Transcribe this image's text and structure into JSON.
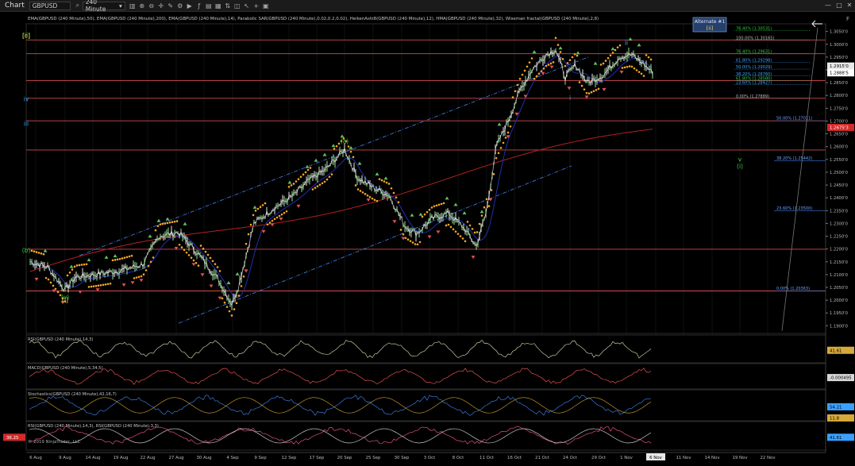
{
  "window": {
    "title": "Chart",
    "instrument": "GBPUSD",
    "timeframe": "240 Minute",
    "minimize": "—",
    "maximize": "□",
    "close": "✕"
  },
  "toolbar_icons": [
    "chart-type-icon",
    "zoom-in-icon",
    "zoom-out-icon",
    "crosshair-icon",
    "draw-tools-icon",
    "properties-icon",
    "strategy-icon",
    "indicators-icon",
    "templates-icon",
    "data-box-icon",
    "show-trades-icon",
    "snapshot-icon",
    "arrow-tools-icon",
    "plus-icon",
    "tile-icon"
  ],
  "main_panel": {
    "indicators_legend": "EMA(GBPUSD (240 Minute),50), EMA(GBPUSD (240 Minute),200), EMA(GBPUSD (240 Minute),14), Parabolic SAR(GBPUSD (240 Minute),0.02,0.2,0.02), HeikenAshi8(GBPUSD (240 Minute),12), HMA(GBPUSD (240 Minute),32), Wiseman fractal(GBPUSD (240 Minute),2,8)",
    "alternate_box": {
      "line1": "Alternate #1",
      "line2": "[ii]"
    },
    "price_ticks": [
      "1.3050'0",
      "1.3000'0",
      "1.2950'0",
      "1.2900'0",
      "1.2850'0",
      "1.2800'0",
      "1.2750'0",
      "1.2700'0",
      "1.2650'0",
      "1.2600'0",
      "1.2550'0",
      "1.2500'0",
      "1.2450'0",
      "1.2400'0",
      "1.2350'0",
      "1.2300'0",
      "1.2250'0",
      "1.2200'0",
      "1.2150'0",
      "1.2100'0",
      "1.2050'0",
      "1.2000'0",
      "1.1950'0",
      "1.1900'0"
    ],
    "price_markers": [
      {
        "label": "1.2915'0",
        "price": 1.2915,
        "bg": "#e8e8e8",
        "fg": "#000000"
      },
      {
        "label": "1.2888'5",
        "price": 1.28885,
        "bg": "#ffffff",
        "fg": "#000000"
      },
      {
        "label": "1.2675'3",
        "price": 1.26753,
        "bg": "#d42a2a",
        "fg": "#ffffff"
      }
    ],
    "fib_levels_upper": [
      {
        "text": "76.40% (1.30531)",
        "price": 1.30531,
        "color": "#2ecc40"
      },
      {
        "text": "100.00% (1.30165)",
        "price": 1.30165,
        "color": "#bbbbbb"
      },
      {
        "text": "76.40% (1.29631)",
        "price": 1.29631,
        "color": "#2ecc40"
      },
      {
        "text": "61.80% (1.29298)",
        "price": 1.29298,
        "color": "#3aa0ff"
      },
      {
        "text": "50.00% (1.29029)",
        "price": 1.29029,
        "color": "#3aa0ff"
      },
      {
        "text": "38.20% (1.28760)",
        "price": 1.2876,
        "color": "#3aa0ff"
      },
      {
        "text": "23.60% (1.28427)",
        "price": 1.28427,
        "color": "#3aa0ff"
      },
      {
        "text": "61.80% (1.28580)",
        "price": 1.2858,
        "color": "#2ecc40"
      },
      {
        "text": "0.00% (1.27889)",
        "price": 1.27889,
        "color": "#bbbbbb"
      }
    ],
    "fib_levels_lower": [
      {
        "text": "50.00% (1.27011)",
        "price": 1.27011
      },
      {
        "text": "38.20% (1.25442)",
        "price": 1.25442
      },
      {
        "text": "23.60% (1.23500)",
        "price": 1.235
      },
      {
        "text": "0.00% (1.20363)",
        "price": 1.20363
      }
    ],
    "wave_labels": [
      {
        "text": "(v)",
        "color": "#2ecc40",
        "date": "9 Aug",
        "price": 1.2003
      },
      {
        "text": "[i]",
        "color": "#e8d44d",
        "date": "9 Aug",
        "price": 1.1992
      },
      {
        "text": "(a)",
        "color": "#2ecc40",
        "date": "20 Sep",
        "price": 1.2613
      },
      {
        "text": "(b)",
        "color": "#2ecc40",
        "date": "28 Sep",
        "price": 1.2187
      },
      {
        "text": "(c)",
        "color": "#2ecc40",
        "date": "20 Oct",
        "price": 1.3026
      },
      {
        "text": "[ii]",
        "color": "#e8d44d",
        "date": "22 Oct",
        "price": 1.3026
      },
      {
        "text": "ii",
        "color": "#3aa0ff",
        "date": "1 Nov",
        "price": 1.2998
      },
      {
        "text": "i",
        "color": "#3aa0ff",
        "date": "24 Oct",
        "price": 1.2782
      },
      {
        "text": "iv",
        "color": "#3aa0ff",
        "date": "16 Nov",
        "price": 1.2778
      },
      {
        "text": "iii",
        "color": "#3aa0ff",
        "date": "9 Nov",
        "price": 1.2681
      },
      {
        "text": "v",
        "color": "#2ecc40",
        "date": "19 Nov",
        "price": 1.2542
      },
      {
        "text": "(i)",
        "color": "#2ecc40",
        "date": "19 Nov",
        "price": 1.2516
      }
    ]
  },
  "subpanels": [
    {
      "name": "rsi-panel",
      "legend": "RSI(GBPUSD (240 Minute),14,3)",
      "value_label": "41.61",
      "value_bg": "#d6a93a"
    },
    {
      "name": "macd-panel",
      "legend": "MACD(GBPUSD (240 Minute),5,34,5)",
      "value_label": "-0.000495",
      "value_bg": "#d8d8d8"
    },
    {
      "name": "stochastics-panel",
      "legend": "Stochastics(GBPUSD (240 Minute),42,16,7)",
      "value_label": "54.21",
      "value_bg": "#3aa0ff",
      "value_label2": "11.8",
      "value_bg2": "#d6a93a"
    },
    {
      "name": "rsi-rsi-panel",
      "legend": "RSI(GBPUSD (240 Minute),14,3), RSI(GBPUSD (240 Minute),3,3)",
      "value_label": "41.61",
      "value_bg": "#3aa0ff",
      "left_value_label": "36.25",
      "left_value_bg": "#d42a2a"
    }
  ],
  "copyright": "© 2019 NinjaTrader, LLC",
  "time_axis": [
    "6 Aug",
    "9 Aug",
    "14 Aug",
    "19 Aug",
    "22 Aug",
    "27 Aug",
    "30 Aug",
    "4 Sep",
    "9 Sep",
    "12 Sep",
    "17 Sep",
    "20 Sep",
    "25 Sep",
    "30 Sep",
    "3 Oct",
    "8 Oct",
    "11 Oct",
    "16 Oct",
    "21 Oct",
    "24 Oct",
    "29 Oct",
    "1 Nov",
    "6 Nov",
    "11 Nov",
    "14 Nov",
    "19 Nov",
    "22 Nov"
  ],
  "current_bar_date": "6 Nov",
  "colors": {
    "horizontal_line": "#d04a4a",
    "channel": "#3a78d8",
    "ema200": "#b02020",
    "ema50": "#2030b0",
    "sar": "#f5a623",
    "up_fractal": "#5fbf5f",
    "down_fractal": "#e05050"
  }
}
